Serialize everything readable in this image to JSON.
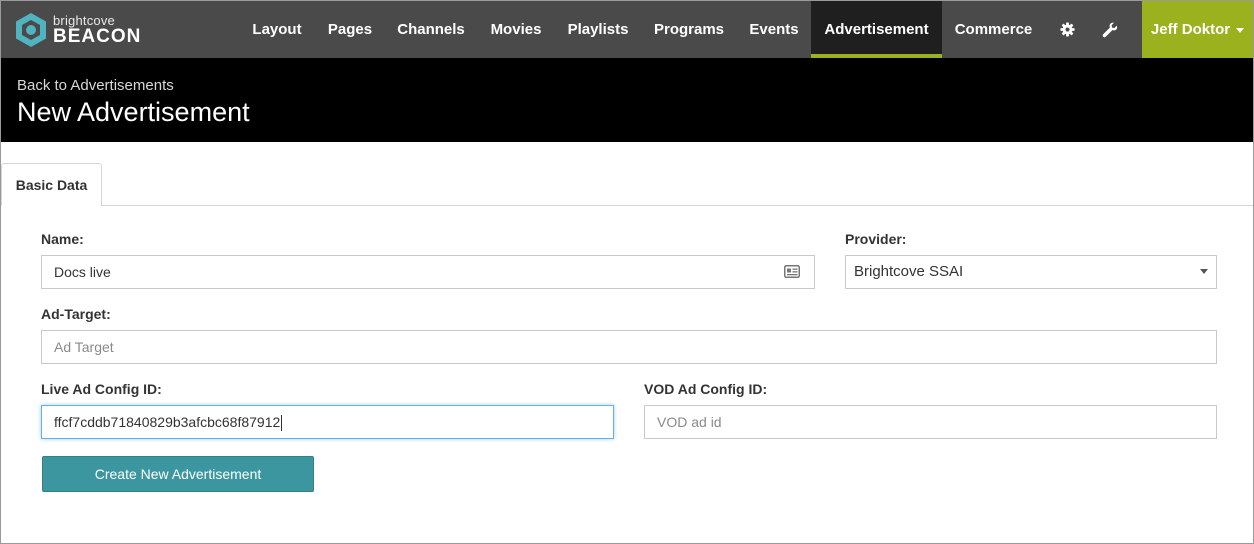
{
  "brand": {
    "small": "brightcove",
    "big": "BEACON",
    "accent": "#9bb11d"
  },
  "nav": {
    "items": [
      {
        "label": "Layout"
      },
      {
        "label": "Pages"
      },
      {
        "label": "Channels"
      },
      {
        "label": "Movies"
      },
      {
        "label": "Playlists"
      },
      {
        "label": "Programs"
      },
      {
        "label": "Events"
      },
      {
        "label": "Advertisement",
        "active": true
      },
      {
        "label": "Commerce"
      }
    ],
    "icons": [
      "gear-icon",
      "wrench-icon"
    ],
    "user": "Jeff Doktor"
  },
  "header": {
    "back_link": "Back to Advertisements",
    "title": "New Advertisement"
  },
  "tabs": [
    {
      "label": "Basic Data",
      "active": true
    }
  ],
  "form": {
    "name": {
      "label": "Name:",
      "value": "Docs live",
      "icon": "contact-card-icon"
    },
    "provider": {
      "label": "Provider:",
      "value": "Brightcove SSAI"
    },
    "ad_target": {
      "label": "Ad-Target:",
      "placeholder": "Ad Target",
      "value": ""
    },
    "live_ad_config": {
      "label": "Live Ad Config ID:",
      "value": "ffcf7cddb71840829b3afcbc68f87912"
    },
    "vod_ad_config": {
      "label": "VOD Ad Config ID:",
      "placeholder": "VOD ad id",
      "value": ""
    },
    "submit_label": "Create New Advertisement"
  }
}
